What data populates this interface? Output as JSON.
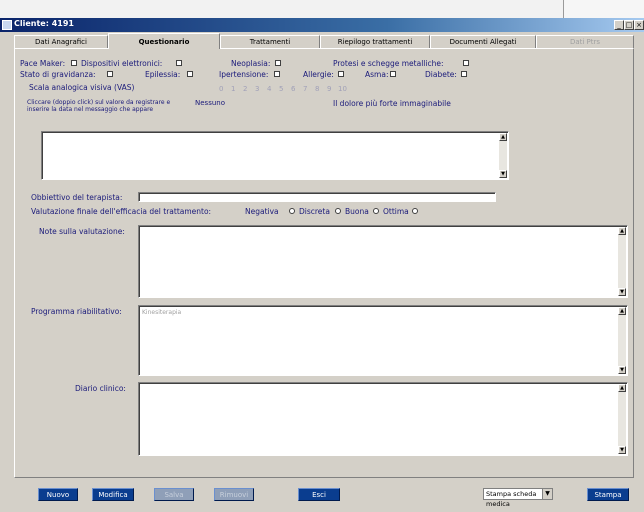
{
  "window": {
    "title": "Cliente: 4191"
  },
  "tabs": [
    {
      "label": "Dati Anagrafici"
    },
    {
      "label": "Questionario"
    },
    {
      "label": "Trattamenti"
    },
    {
      "label": "Riepilogo trattamenti"
    },
    {
      "label": "Documenti Allegati"
    },
    {
      "label": "Dati Ptrs"
    }
  ],
  "questionnaire": {
    "row1": {
      "pacemaker": "Pace Maker:",
      "dispositivi": "Dispositivi elettronici:",
      "neoplasia": "Neoplasia:",
      "protesi": "Protesi e schegge metalliche:"
    },
    "row2": {
      "gravidanza": "Stato di gravidanza:",
      "epilessia": "Epilessia:",
      "ipertensione": "Ipertensione:",
      "allergie": "Allergie:",
      "asma": "Asma:",
      "diabete": "Diabete:"
    },
    "vas": {
      "label": "Scala analogica visiva (VAS)",
      "numbers": [
        "0",
        "1",
        "2",
        "3",
        "4",
        "5",
        "6",
        "7",
        "8",
        "9",
        "10"
      ],
      "min_label": "Nessuno",
      "max_label": "Il dolore più forte immaginabile",
      "instructions": "Cliccare (doppio click) sul valore da registrare e inserire la data nel messaggio che appare"
    },
    "obiettivo_label": "Obbiettivo del terapista:",
    "valutazione": {
      "label": "Valutazione finale dell'efficacia del trattamento:",
      "options": [
        "Negativa",
        "Discreta",
        "Buona",
        "Ottima"
      ]
    },
    "note_label": "Note sulla valutazione:",
    "programma_label": "Programma riabilitativo:",
    "programma_value": "Kinesiterapia",
    "diario_label": "Diario clinico:"
  },
  "footer": {
    "buttons": [
      "Nuovo",
      "Modifica",
      "Salva",
      "Rimuovi",
      "Esci"
    ],
    "print_select": "Stampa scheda medica",
    "print_button": "Stampa"
  },
  "colors": {
    "title_bar": "#0a246a",
    "button_blue": "#0a3d8f",
    "label_blue": "#1a1a7a",
    "face": "#d4d0c8"
  }
}
